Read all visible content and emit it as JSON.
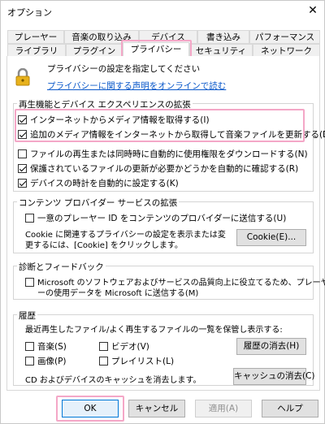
{
  "window": {
    "title": "オプション",
    "close_glyph": "✕"
  },
  "tabs_row1": [
    "プレーヤー",
    "音楽の取り込み",
    "デバイス",
    "書き込み",
    "パフォーマンス"
  ],
  "tabs_row2": [
    "ライブラリ",
    "プラグイン",
    "プライバシー",
    "セキュリティ",
    "ネットワーク"
  ],
  "header": {
    "title": "プライバシーの設定を指定してください",
    "link": "プライバシーに関する声明をオンラインで読む"
  },
  "playback": {
    "label": "再生機能とデバイス エクスペリエンスの拡張",
    "items": [
      {
        "text": "インターネットからメディア情報を取得する(I)",
        "checked": true
      },
      {
        "text": "追加のメディア情報をインターネットから取得して音楽ファイルを更新する(D)",
        "checked": true
      },
      {
        "text": "ファイルの再生または同時時に自動的に使用権限をダウンロードする(N)",
        "checked": false
      },
      {
        "text": "保護されているファイルの更新が必要かどうかを自動的に確認する(R)",
        "checked": true
      },
      {
        "text": "デバイスの時計を自動的に設定する(K)",
        "checked": true
      }
    ]
  },
  "content_provider": {
    "label": "コンテンツ プロバイダー サービスの拡張",
    "checkbox": "一意のプレーヤー ID をコンテンツのプロバイダーに送信する(U)",
    "desc1": "Cookie に関連するプライバシーの設定を表示または変",
    "desc2": "更するには、[Cookie] をクリックします。",
    "cookie_button": "Cookie(E)..."
  },
  "diagnostics": {
    "label": "診断とフィードバック",
    "line1": "Microsoft のソフトウェアおよびサービスの品質向上に役立てるため、プレーヤ",
    "line2": "ーの使用データを Microsoft に送信する(M)"
  },
  "history": {
    "label": "履歴",
    "desc": "最近再生したファイル/よく再生するファイルの一覧を保管し表示する:",
    "music": "音楽(S)",
    "video": "ビデオ(V)",
    "pictures": "画像(P)",
    "playlist": "プレイリスト(L)",
    "clear_history": "履歴の消去(H)",
    "cache_text": "CD およびデバイスのキャッシュを消去します。",
    "clear_cache": "キャッシュの消去(C)"
  },
  "buttons": {
    "ok": "OK",
    "cancel": "キャンセル",
    "apply": "適用(A)",
    "help": "ヘルプ"
  },
  "colors": {
    "highlight": "#f4a7c7",
    "link": "#0a58ca",
    "lock": "#e8b21c"
  }
}
